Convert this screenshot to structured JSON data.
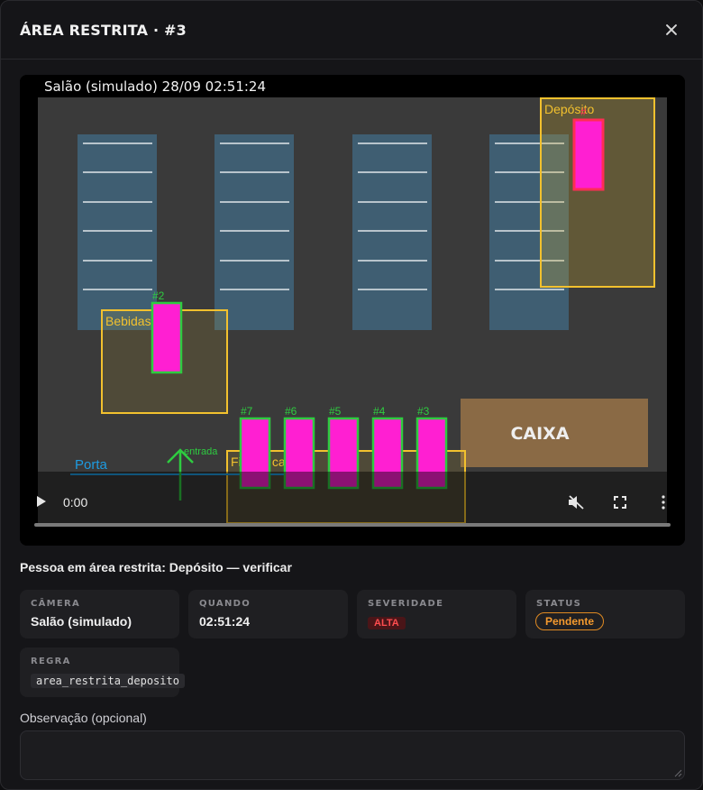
{
  "modal": {
    "title": "ÁREA RESTRITA · #3"
  },
  "video": {
    "overlay_text": "Salão (simulado) 28/09 02:51:24",
    "zones": {
      "deposito": "Depósito",
      "bebidas": "Bebidas",
      "fila_caixa": "Fila do caixa 1",
      "caixa": "CAIXA",
      "porta": "Porta",
      "entrada": "entrada"
    },
    "tracks": [
      "#2",
      "#7",
      "#6",
      "#5",
      "#4",
      "#3"
    ],
    "current_time": "0:00",
    "progress": 0,
    "colors": {
      "zone": "#f2c12e",
      "restricted_person": "#ff2d55",
      "person_fill": "#ff1fd2",
      "track_box": "#2ecc40",
      "porta_line": "#1e9be0",
      "caixa": "#8a6a45"
    }
  },
  "alert": {
    "message": "Pessoa em área restrita: Depósito — verificar"
  },
  "details": {
    "camera": {
      "label": "CÂMERA",
      "value": "Salão (simulado)"
    },
    "quando": {
      "label": "QUANDO",
      "value": "02:51:24"
    },
    "severidade": {
      "label": "SEVERIDADE",
      "value": "ALTA"
    },
    "status": {
      "label": "STATUS",
      "value": "Pendente"
    },
    "regra": {
      "label": "REGRA",
      "value": "area_restrita_deposito"
    }
  },
  "observacao": {
    "label": "Observação (opcional)",
    "placeholder": "",
    "value": ""
  },
  "icons": {
    "close": "close-icon",
    "play": "play-icon",
    "mute": "mute-icon",
    "fullscreen": "fullscreen-icon",
    "more": "more-vertical-icon",
    "entry_arrow": "arrow-up-icon"
  }
}
